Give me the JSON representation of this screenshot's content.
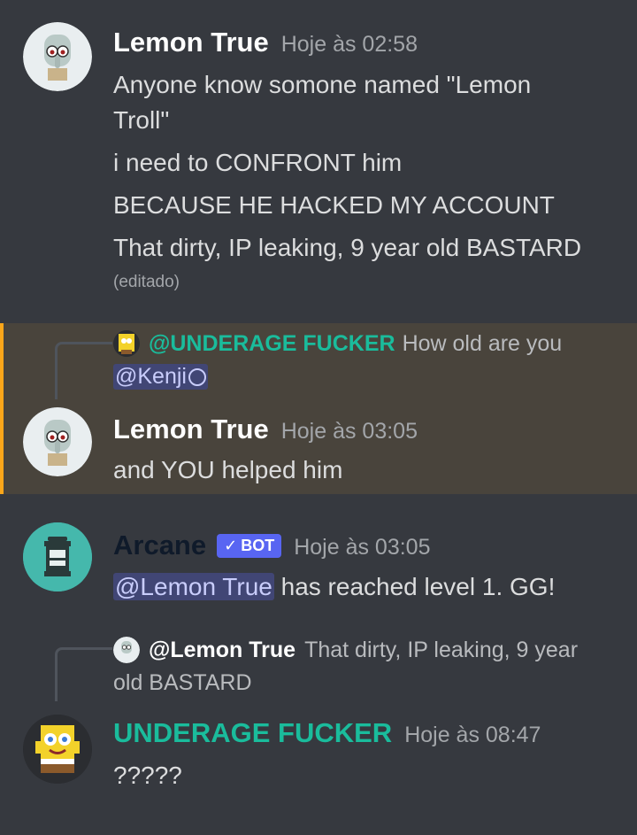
{
  "messages": [
    {
      "author": "Lemon True",
      "author_color": "#ffffff",
      "timestamp": "Hoje às 02:58",
      "lines": [
        "Anyone know somone named \"Lemon",
        "Troll\"",
        "i need to CONFRONT him",
        "BECAUSE HE HACKED MY ACCOUNT",
        "That dirty, IP leaking, 9 year old BASTARD"
      ],
      "edited": "(editado)",
      "avatar": "squidward-avatar"
    },
    {
      "reply_to": {
        "author": "@UNDERAGE FUCKER",
        "text": "How old are you",
        "mention": "@Kenji",
        "icon": "circle-icon"
      },
      "author": "Lemon True",
      "timestamp": "Hoje às 03:05",
      "text": "and YOU helped him",
      "highlight_color": "#49443c",
      "accent_color": "#faa61a"
    },
    {
      "author": "Arcane",
      "author_color": "#0f1a2a",
      "bot_label": "BOT",
      "timestamp": "Hoje às 03:05",
      "mention": "@Lemon True",
      "text": " has reached level 1. GG!",
      "avatar": "lantern-avatar"
    },
    {
      "reply_to": {
        "author": "@Lemon True",
        "text": "That dirty, IP leaking, 9 year",
        "text2": "old BASTARD"
      },
      "author": "UNDERAGE FUCKER",
      "author_color": "#1abc9c",
      "timestamp": "Hoje às 08:47",
      "text": "?????",
      "avatar": "spongebob-avatar"
    }
  ]
}
